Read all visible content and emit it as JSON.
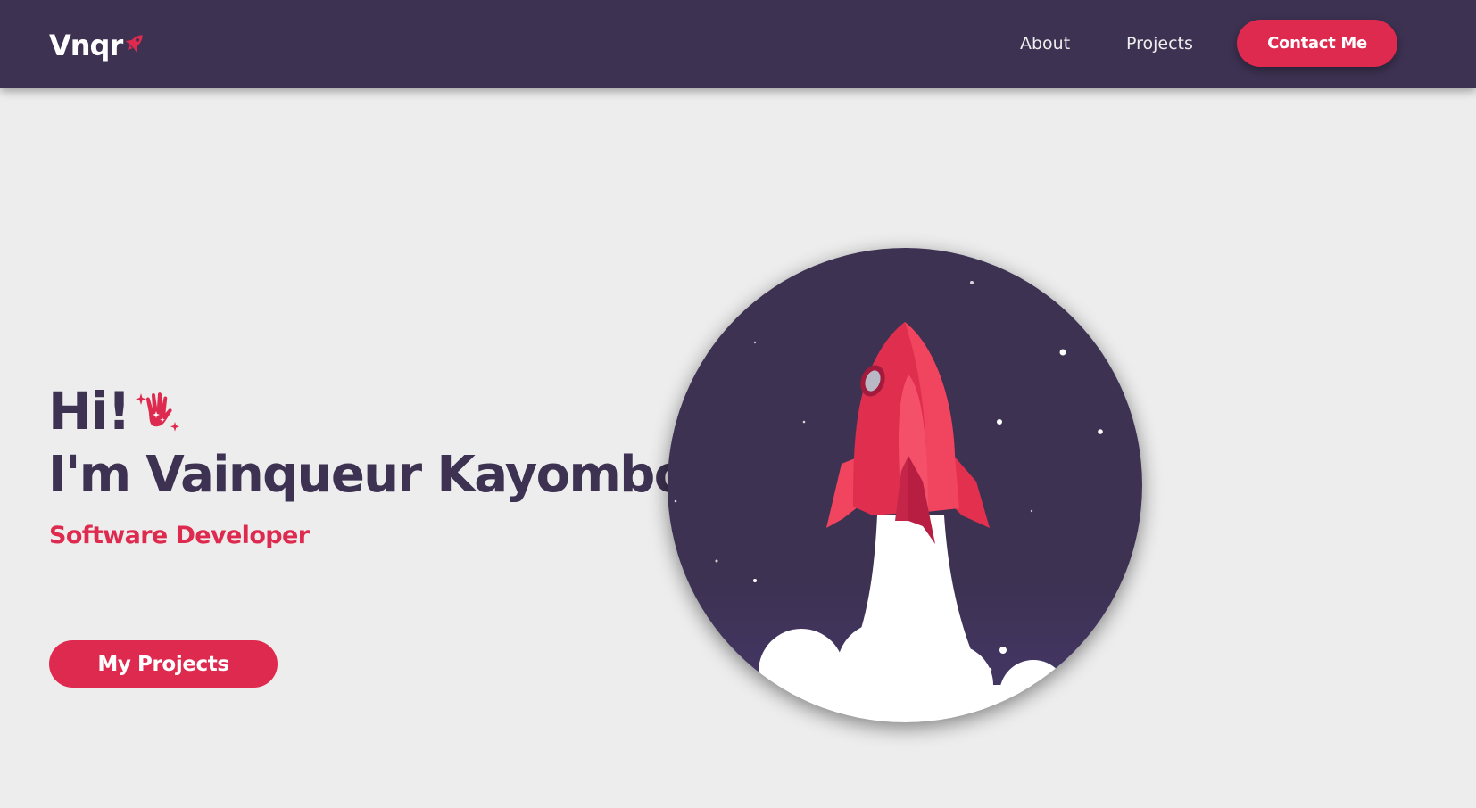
{
  "brand": {
    "logo_text": "Vnqr",
    "logo_icon": "rocket-icon",
    "accent_color": "#de2a4e",
    "primary_color": "#3d3252",
    "background_color": "#ededed"
  },
  "nav": {
    "links": [
      {
        "label": "About"
      },
      {
        "label": "Projects"
      }
    ],
    "cta_label": "Contact Me"
  },
  "hero": {
    "greeting": "Hi!",
    "greeting_icon": "waving-hand-icon",
    "name": "I'm Vainqueur Kayombo",
    "role": "Software Developer",
    "button_label": "My Projects",
    "illustration": "rocket-launch-illustration"
  }
}
